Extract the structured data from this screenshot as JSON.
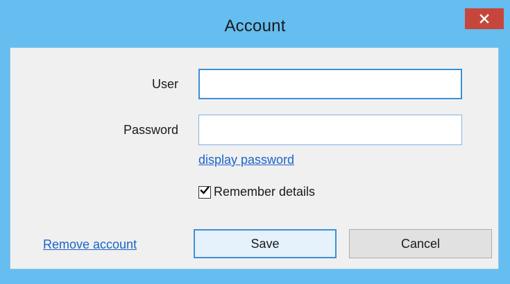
{
  "window": {
    "title": "Account",
    "close_icon": "close-icon",
    "accent_color": "#65bdf0",
    "close_color": "#c7463c"
  },
  "form": {
    "user_label": "User",
    "user_value": "",
    "password_label": "Password",
    "password_value": "",
    "display_password_link": "display password",
    "remember_label": "Remember details",
    "remember_checked": true
  },
  "actions": {
    "remove_account_link": "Remove account",
    "save_label": "Save",
    "cancel_label": "Cancel"
  }
}
